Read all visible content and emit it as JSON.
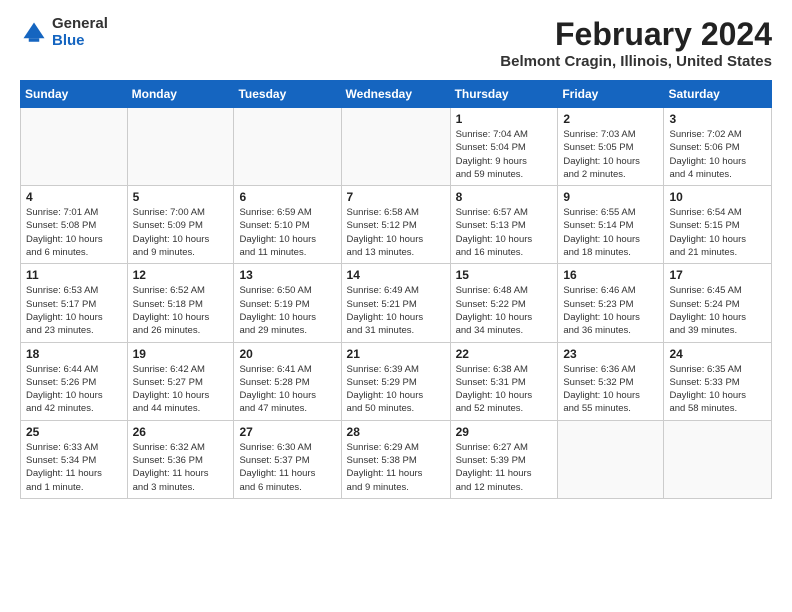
{
  "header": {
    "logo_general": "General",
    "logo_blue": "Blue",
    "month_year": "February 2024",
    "location": "Belmont Cragin, Illinois, United States"
  },
  "weekdays": [
    "Sunday",
    "Monday",
    "Tuesday",
    "Wednesday",
    "Thursday",
    "Friday",
    "Saturday"
  ],
  "weeks": [
    [
      {
        "day": "",
        "info": ""
      },
      {
        "day": "",
        "info": ""
      },
      {
        "day": "",
        "info": ""
      },
      {
        "day": "",
        "info": ""
      },
      {
        "day": "1",
        "info": "Sunrise: 7:04 AM\nSunset: 5:04 PM\nDaylight: 9 hours\nand 59 minutes."
      },
      {
        "day": "2",
        "info": "Sunrise: 7:03 AM\nSunset: 5:05 PM\nDaylight: 10 hours\nand 2 minutes."
      },
      {
        "day": "3",
        "info": "Sunrise: 7:02 AM\nSunset: 5:06 PM\nDaylight: 10 hours\nand 4 minutes."
      }
    ],
    [
      {
        "day": "4",
        "info": "Sunrise: 7:01 AM\nSunset: 5:08 PM\nDaylight: 10 hours\nand 6 minutes."
      },
      {
        "day": "5",
        "info": "Sunrise: 7:00 AM\nSunset: 5:09 PM\nDaylight: 10 hours\nand 9 minutes."
      },
      {
        "day": "6",
        "info": "Sunrise: 6:59 AM\nSunset: 5:10 PM\nDaylight: 10 hours\nand 11 minutes."
      },
      {
        "day": "7",
        "info": "Sunrise: 6:58 AM\nSunset: 5:12 PM\nDaylight: 10 hours\nand 13 minutes."
      },
      {
        "day": "8",
        "info": "Sunrise: 6:57 AM\nSunset: 5:13 PM\nDaylight: 10 hours\nand 16 minutes."
      },
      {
        "day": "9",
        "info": "Sunrise: 6:55 AM\nSunset: 5:14 PM\nDaylight: 10 hours\nand 18 minutes."
      },
      {
        "day": "10",
        "info": "Sunrise: 6:54 AM\nSunset: 5:15 PM\nDaylight: 10 hours\nand 21 minutes."
      }
    ],
    [
      {
        "day": "11",
        "info": "Sunrise: 6:53 AM\nSunset: 5:17 PM\nDaylight: 10 hours\nand 23 minutes."
      },
      {
        "day": "12",
        "info": "Sunrise: 6:52 AM\nSunset: 5:18 PM\nDaylight: 10 hours\nand 26 minutes."
      },
      {
        "day": "13",
        "info": "Sunrise: 6:50 AM\nSunset: 5:19 PM\nDaylight: 10 hours\nand 29 minutes."
      },
      {
        "day": "14",
        "info": "Sunrise: 6:49 AM\nSunset: 5:21 PM\nDaylight: 10 hours\nand 31 minutes."
      },
      {
        "day": "15",
        "info": "Sunrise: 6:48 AM\nSunset: 5:22 PM\nDaylight: 10 hours\nand 34 minutes."
      },
      {
        "day": "16",
        "info": "Sunrise: 6:46 AM\nSunset: 5:23 PM\nDaylight: 10 hours\nand 36 minutes."
      },
      {
        "day": "17",
        "info": "Sunrise: 6:45 AM\nSunset: 5:24 PM\nDaylight: 10 hours\nand 39 minutes."
      }
    ],
    [
      {
        "day": "18",
        "info": "Sunrise: 6:44 AM\nSunset: 5:26 PM\nDaylight: 10 hours\nand 42 minutes."
      },
      {
        "day": "19",
        "info": "Sunrise: 6:42 AM\nSunset: 5:27 PM\nDaylight: 10 hours\nand 44 minutes."
      },
      {
        "day": "20",
        "info": "Sunrise: 6:41 AM\nSunset: 5:28 PM\nDaylight: 10 hours\nand 47 minutes."
      },
      {
        "day": "21",
        "info": "Sunrise: 6:39 AM\nSunset: 5:29 PM\nDaylight: 10 hours\nand 50 minutes."
      },
      {
        "day": "22",
        "info": "Sunrise: 6:38 AM\nSunset: 5:31 PM\nDaylight: 10 hours\nand 52 minutes."
      },
      {
        "day": "23",
        "info": "Sunrise: 6:36 AM\nSunset: 5:32 PM\nDaylight: 10 hours\nand 55 minutes."
      },
      {
        "day": "24",
        "info": "Sunrise: 6:35 AM\nSunset: 5:33 PM\nDaylight: 10 hours\nand 58 minutes."
      }
    ],
    [
      {
        "day": "25",
        "info": "Sunrise: 6:33 AM\nSunset: 5:34 PM\nDaylight: 11 hours\nand 1 minute."
      },
      {
        "day": "26",
        "info": "Sunrise: 6:32 AM\nSunset: 5:36 PM\nDaylight: 11 hours\nand 3 minutes."
      },
      {
        "day": "27",
        "info": "Sunrise: 6:30 AM\nSunset: 5:37 PM\nDaylight: 11 hours\nand 6 minutes."
      },
      {
        "day": "28",
        "info": "Sunrise: 6:29 AM\nSunset: 5:38 PM\nDaylight: 11 hours\nand 9 minutes."
      },
      {
        "day": "29",
        "info": "Sunrise: 6:27 AM\nSunset: 5:39 PM\nDaylight: 11 hours\nand 12 minutes."
      },
      {
        "day": "",
        "info": ""
      },
      {
        "day": "",
        "info": ""
      }
    ]
  ]
}
